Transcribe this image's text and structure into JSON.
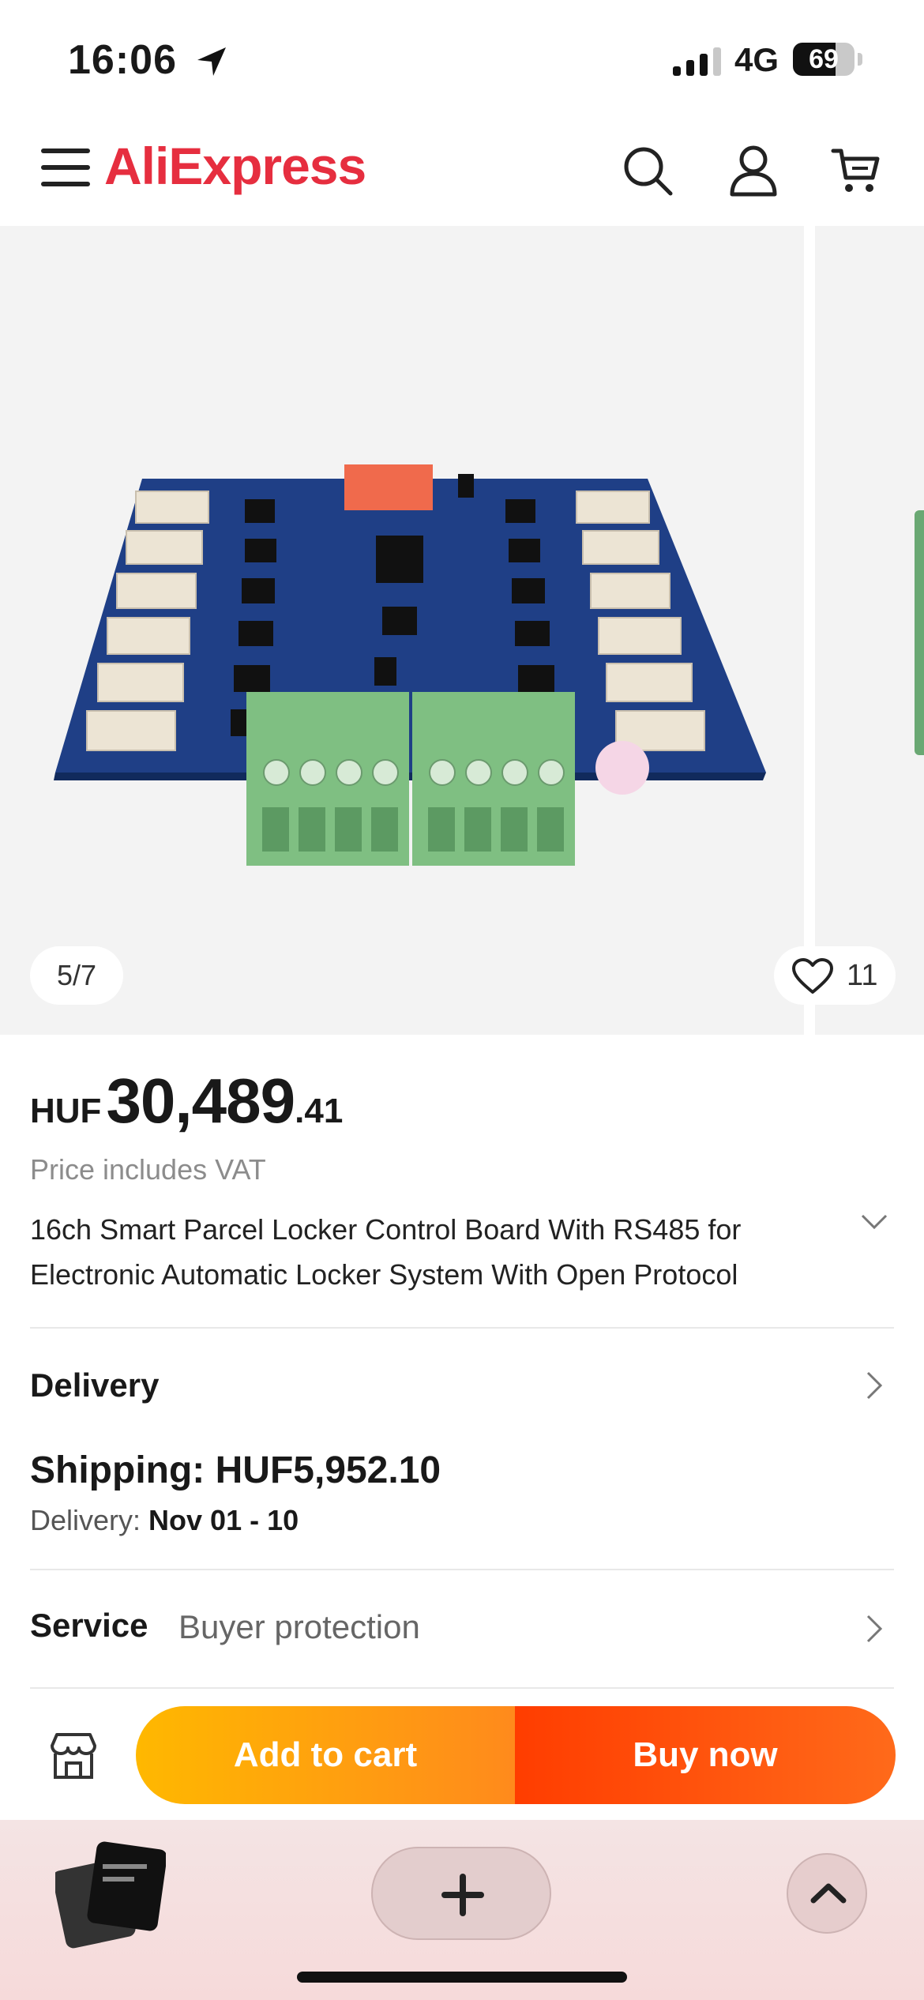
{
  "status_bar": {
    "time": "16:06",
    "network": "4G",
    "battery_level": 69,
    "battery_text": "69"
  },
  "header": {
    "logo": "AliExpress",
    "icons": [
      "menu-icon",
      "search-icon",
      "account-icon",
      "cart-icon"
    ]
  },
  "gallery": {
    "pager": "5/7",
    "wishlist_count": "11"
  },
  "product": {
    "currency": "HUF",
    "price_integer": "30,489",
    "price_decimal": ".41",
    "vat_note": "Price includes VAT",
    "title": "16ch Smart Parcel Locker Control Board With RS485 for Electronic Automatic Locker System With Open Protocol"
  },
  "delivery": {
    "label": "Delivery",
    "shipping": "Shipping: HUF5,952.10",
    "delivery_label": "Delivery: ",
    "delivery_dates": "Nov 01 - 10"
  },
  "service": {
    "label": "Service",
    "value": "Buyer protection"
  },
  "actions": {
    "add_to_cart": "Add to cart",
    "buy_now": "Buy now"
  },
  "colors": {
    "brand_red": "#e62e3f",
    "cart_gradient_start": "#ffb800",
    "buy_gradient_start": "#ff3d00"
  }
}
